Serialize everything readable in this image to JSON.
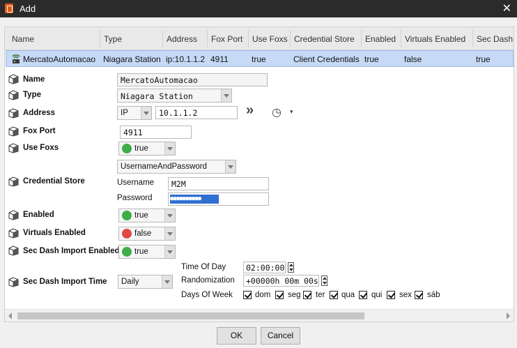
{
  "window": {
    "title": "Add",
    "close_glyph": "✕",
    "app_icon": "niagara-app-icon"
  },
  "table": {
    "columns": [
      "Name",
      "Type",
      "Address",
      "Fox Port",
      "Use Foxs",
      "Credential Store",
      "Enabled",
      "Virtuals Enabled",
      "Sec Dash"
    ],
    "rows": [
      {
        "icon": "station-icon",
        "cells": [
          "MercatoAutomacao",
          "Niagara Station",
          "ip:10.1.1.2",
          "4911",
          "true",
          "Client Credentials",
          "true",
          "false",
          "true"
        ]
      }
    ]
  },
  "form": {
    "name": {
      "label": "Name",
      "value": "MercatoAutomacao"
    },
    "type": {
      "label": "Type",
      "value": "Niagara Station"
    },
    "address": {
      "label": "Address",
      "scheme": "IP",
      "value": "10.1.1.2",
      "go_glyph": "»",
      "history_glyph": "◷",
      "history_menu_glyph": "▾"
    },
    "fox_port": {
      "label": "Fox Port",
      "value": "4911"
    },
    "use_foxs": {
      "label": "Use Foxs",
      "value": "true",
      "status_color": "#3fae49"
    },
    "credential_store": {
      "label": "Credential Store",
      "mode": "UsernameAndPassword",
      "username_label": "Username",
      "username": "M2M",
      "password_label": "Password",
      "password_mask": "●●●●●●●●●●"
    },
    "enabled": {
      "label": "Enabled",
      "value": "true",
      "status_color": "#3fae49"
    },
    "virtuals_enabled": {
      "label": "Virtuals Enabled",
      "value": "false",
      "status_color": "#e04848"
    },
    "sec_dash_import_enabled": {
      "label": "Sec Dash Import Enabled",
      "value": "true",
      "status_color": "#3fae49"
    },
    "sec_dash_import_time": {
      "label": "Sec Dash Import Time",
      "frequency": "Daily",
      "time_of_day_label": "Time Of Day",
      "time_of_day": "02:00:00",
      "randomization_label": "Randomization",
      "randomization": "+00000h 00m 00s",
      "days_of_week_label": "Days Of Week",
      "days": [
        "dom",
        "seg",
        "ter",
        "qua",
        "qui",
        "sex",
        "sáb"
      ]
    }
  },
  "buttons": {
    "ok": "OK",
    "cancel": "Cancel"
  },
  "colors": {
    "selection": "#c6daf6",
    "titlebar": "#2b2b2b",
    "true_dot": "#3fae49",
    "false_dot": "#e04848"
  }
}
